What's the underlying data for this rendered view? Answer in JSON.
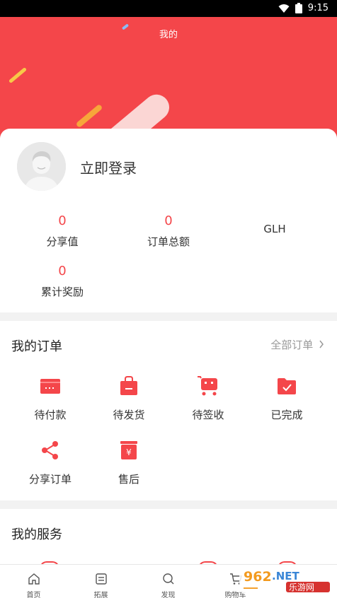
{
  "status_bar": {
    "time": "9:15"
  },
  "header": {
    "title": "我的"
  },
  "profile": {
    "login_label": "立即登录"
  },
  "stats": [
    {
      "value": "0",
      "label": "分享值"
    },
    {
      "value": "0",
      "label": "订单总额"
    },
    {
      "value": "",
      "label": "GLH"
    },
    {
      "value": "0",
      "label": "累计奖励"
    }
  ],
  "orders": {
    "title": "我的订单",
    "all_label": "全部订单",
    "items": [
      {
        "label": "待付款",
        "icon": "card-icon"
      },
      {
        "label": "待发货",
        "icon": "bag-icon"
      },
      {
        "label": "待签收",
        "icon": "cart-icon"
      },
      {
        "label": "已完成",
        "icon": "folder-check-icon"
      },
      {
        "label": "分享订单",
        "icon": "share-icon"
      },
      {
        "label": "售后",
        "icon": "yen-box-icon"
      }
    ]
  },
  "services": {
    "title": "我的服务"
  },
  "tabbar": [
    {
      "label": "首页",
      "icon": "home-icon"
    },
    {
      "label": "拓展",
      "icon": "list-icon"
    },
    {
      "label": "发现",
      "icon": "search-icon"
    },
    {
      "label": "购物车",
      "icon": "cart-icon"
    }
  ],
  "watermark": {
    "text": "962.NET 乐游网"
  },
  "colors": {
    "accent": "#f4464a",
    "text": "#333333",
    "muted": "#999999",
    "background": "#f2f2f2"
  }
}
